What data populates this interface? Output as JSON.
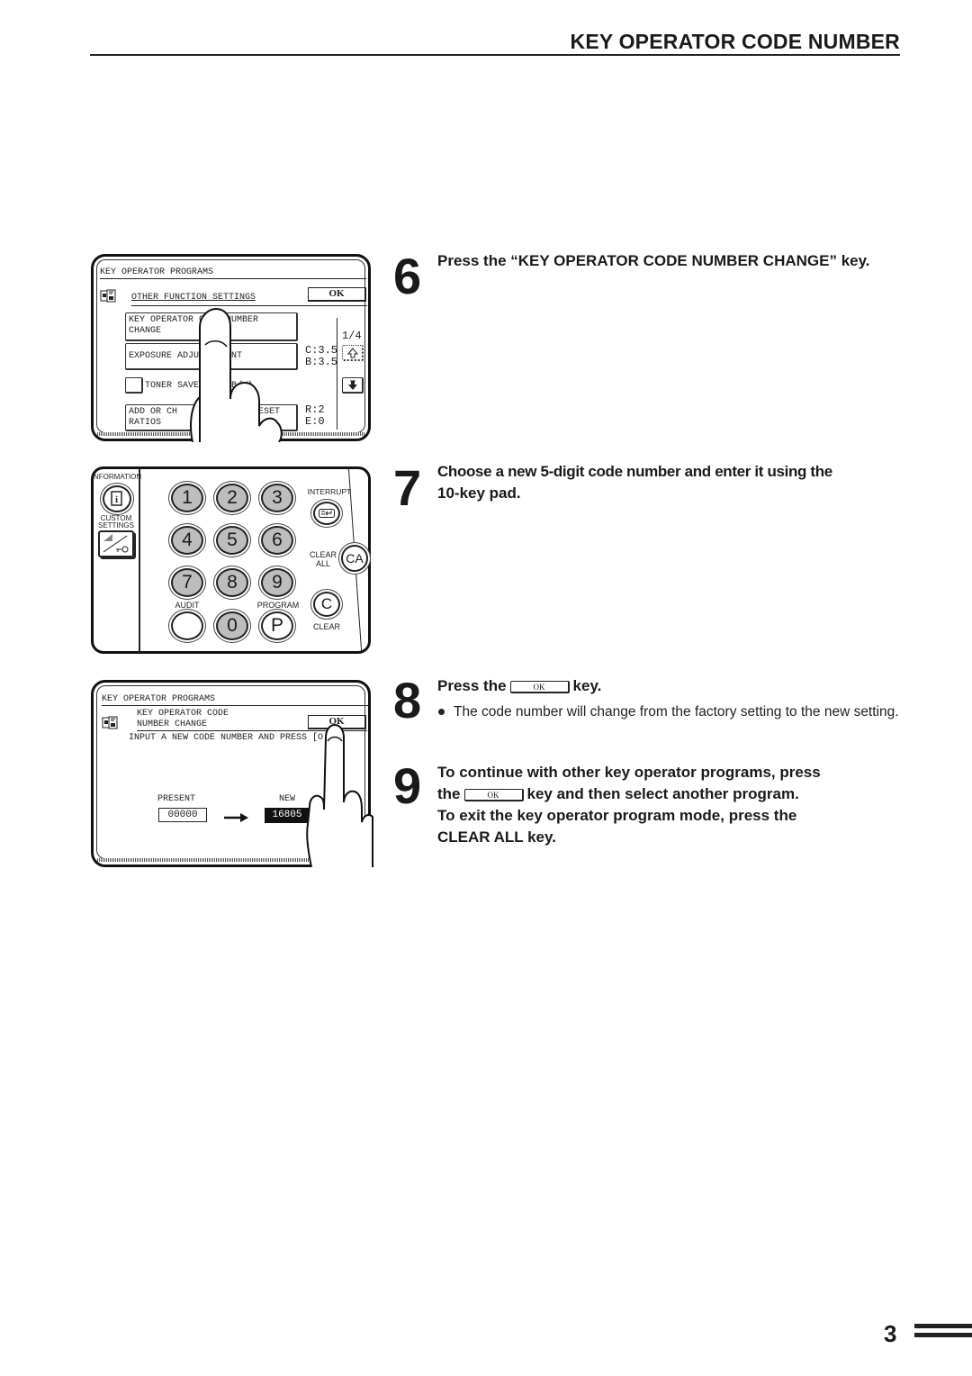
{
  "header": {
    "title": "KEY OPERATOR CODE NUMBER"
  },
  "screen1": {
    "title": "KEY OPERATOR PROGRAMS",
    "section": "OTHER FUNCTION SETTINGS",
    "ok_label": "OK",
    "icon": "document-copy-icon",
    "items": [
      {
        "label": "KEY OPERATOR CODE NUMBER\nCHANGE",
        "value": ""
      },
      {
        "label": "EXPOSURE ADJU      NT",
        "value": "C:3.5\nB:3.5"
      },
      {
        "label": "TONER SAVE    E(B/W)",
        "value": "",
        "type": "checkbox"
      },
      {
        "label": "ADD OR CH              RESET\nRATIOS",
        "value": "R:2\nE:0"
      }
    ],
    "page_indicator": "1/4",
    "scroll_up_icon": "arrow-up-icon",
    "scroll_down_icon": "arrow-down-icon"
  },
  "keypad": {
    "information_label": "NFORMATION",
    "information_icon": "info-icon",
    "custom_settings_label": "CUSTOM\nSETTINGS",
    "custom_settings_icon": "key-settings-icon",
    "digits": [
      "1",
      "2",
      "3",
      "4",
      "5",
      "6",
      "7",
      "8",
      "9"
    ],
    "zero": "0",
    "audit_label": "AUDIT",
    "program_label": "PROGRAM",
    "program_key": "P",
    "interrupt_label": "INTERRUPT",
    "interrupt_icon": "interrupt-icon",
    "clear_all_label": "CLEAR\nALL",
    "clear_all_key": "CA",
    "clear_label": "CLEAR",
    "clear_key": "C"
  },
  "screen2": {
    "title": "KEY OPERATOR PROGRAMS",
    "section": "KEY OPERATOR CODE\nNUMBER CHANGE",
    "ok_label": "OK",
    "instruction": "INPUT A NEW CODE NUMBER AND PRESS [O",
    "present_label": "PRESENT",
    "present_value": "00000",
    "new_label": "NEW",
    "new_value": "16805",
    "arrow_icon": "arrow-right-icon"
  },
  "steps": [
    {
      "number": "6",
      "title": "Press the “KEY OPERATOR CODE NUMBER CHANGE” key."
    },
    {
      "number": "7",
      "title_line1": "Choose a new 5-digit code number and enter it using the",
      "title_line2": "10-key pad."
    },
    {
      "number": "8",
      "title_before": "Press the",
      "ok_label": "OK",
      "title_after": "key.",
      "bullet": "The code number will change from the factory setting to the new setting."
    },
    {
      "number": "9",
      "line1": "To continue with other key operator programs, press",
      "line2_before": "the",
      "ok_label": "OK",
      "line2_after": "key and then select another program.",
      "line3": "To exit the key operator program mode, press the",
      "line4": "CLEAR ALL key."
    }
  ],
  "footer": {
    "page_number": "3"
  }
}
